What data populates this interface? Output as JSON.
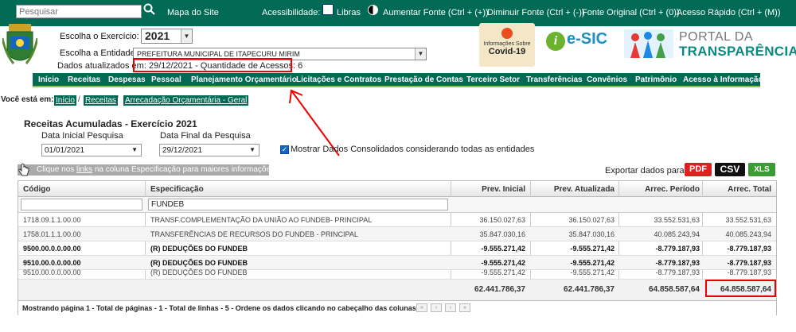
{
  "topbar": {
    "search_placeholder": "Pesquisar",
    "site_map": "Mapa do Site",
    "accessibility": "Acessibilidade:",
    "libras": "Libras",
    "increase_font": "Aumentar Fonte (Ctrl + (+))",
    "decrease_font": "Diminuir Fonte (Ctrl + (-))",
    "original_font": "Fonte Original (Ctrl + (0))",
    "quick_access": "Acesso Rápido (Ctrl + (M))"
  },
  "header": {
    "year_label": "Escolha o Exercício:",
    "year_value": "2021",
    "entity_label": "Escolha a Entidade:",
    "entity_value": "PREFEITURA MUNICIPAL DE ITAPECURU MIRIM",
    "updated_label": "Dados atualizados em:",
    "updated_value": "29/12/2021 - Quantidade de Acessos: 6",
    "covid_small": "Informações Sobre",
    "covid_big": "Covid-19",
    "esic": "e-SIC",
    "portal_t1": "PORTAL DA",
    "portal_t2": "TRANSPARÊNCIA"
  },
  "nav": [
    "Início",
    "Receitas",
    "Despesas",
    "Pessoal",
    "Planejamento Orçamentário",
    "Licitações e Contratos",
    "Prestação de Contas",
    "Terceiro Setor",
    "Transferências",
    "Convênios",
    "Patrimônio",
    "Acesso à Informação"
  ],
  "breadcrumb": {
    "label": "Você está em:",
    "items": [
      "Início",
      "Receitas",
      "Arrecadação Orçamentária - Geral"
    ]
  },
  "page": {
    "title": "Receitas Acumuladas - Exercício 2021",
    "start_label": "Data Inicial Pesquisa",
    "start_value": "01/01/2021",
    "end_label": "Data Final da Pesquisa",
    "end_value": "29/12/2021",
    "consolidated_label": "Mostrar Dados Consolidados considerando todas as entidades",
    "info_pre": "Clique nos ",
    "info_link": "links",
    "info_post": " na coluna Especificação para maiores informações.",
    "export_label": "Exportar dados para:",
    "pdf": "PDF",
    "csv": "CSV",
    "xls": "XLS"
  },
  "table": {
    "headers": [
      "Código",
      "Especificação",
      "Prev. Inicial",
      "Prev. Atualizada",
      "Arrec. Período",
      "Arrec. Total"
    ],
    "filter_codigo": "",
    "filter_especificacao": "FUNDEB",
    "rows": [
      {
        "codigo": "1718.09.1.1.00.00",
        "espec": "TRANSF.COMPLEMENTAÇÃO DA UNIÃO AO FUNDEB- PRINCIPAL",
        "prev_inicial": "36.150.027,63",
        "prev_atual": "36.150.027,63",
        "arrec_periodo": "33.552.531,63",
        "arrec_total": "33.552.531,63",
        "bold": false
      },
      {
        "codigo": "1758.01.1.1.00.00",
        "espec": "TRANSFERÊNCIAS DE RECURSOS DO FUNDEB - PRINCIPAL",
        "prev_inicial": "35.847.030,16",
        "prev_atual": "35.847.030,16",
        "arrec_periodo": "40.085.243,94",
        "arrec_total": "40.085.243,94",
        "bold": false
      },
      {
        "codigo": "9500.00.0.0.00.00",
        "espec": "(R) DEDUÇÕES DO FUNDEB",
        "prev_inicial": "-9.555.271,42",
        "prev_atual": "-9.555.271,42",
        "arrec_periodo": "-8.779.187,93",
        "arrec_total": "-8.779.187,93",
        "bold": true
      },
      {
        "codigo": "9510.00.0.0.00.00",
        "espec": "(R) DEDUÇÕES DO FUNDEB",
        "prev_inicial": "-9.555.271,42",
        "prev_atual": "-9.555.271,42",
        "arrec_periodo": "-8.779.187,93",
        "arrec_total": "-8.779.187,93",
        "bold": true
      },
      {
        "codigo": "9510.00.0.0.00.00",
        "espec": "(R) DEDUÇÕES DO FUNDEB",
        "prev_inicial": "-9.555.271,42",
        "prev_atual": "-9.555.271,42",
        "arrec_periodo": "-8.779.187,93",
        "arrec_total": "-8.779.187,93",
        "bold": false
      }
    ],
    "totals": {
      "prev_inicial": "62.441.786,37",
      "prev_atual": "62.441.786,37",
      "arrec_periodo": "64.858.587,64",
      "arrec_total": "64.858.587,64"
    },
    "pager_text": "Mostrando página 1 - Total de páginas - 1 - Total de linhas - 5 - Ordene os dados clicando no cabeçalho das colunas."
  },
  "colors": {
    "brand": "#006a54",
    "accent": "#8bc34a",
    "highlight": "#e00000"
  }
}
